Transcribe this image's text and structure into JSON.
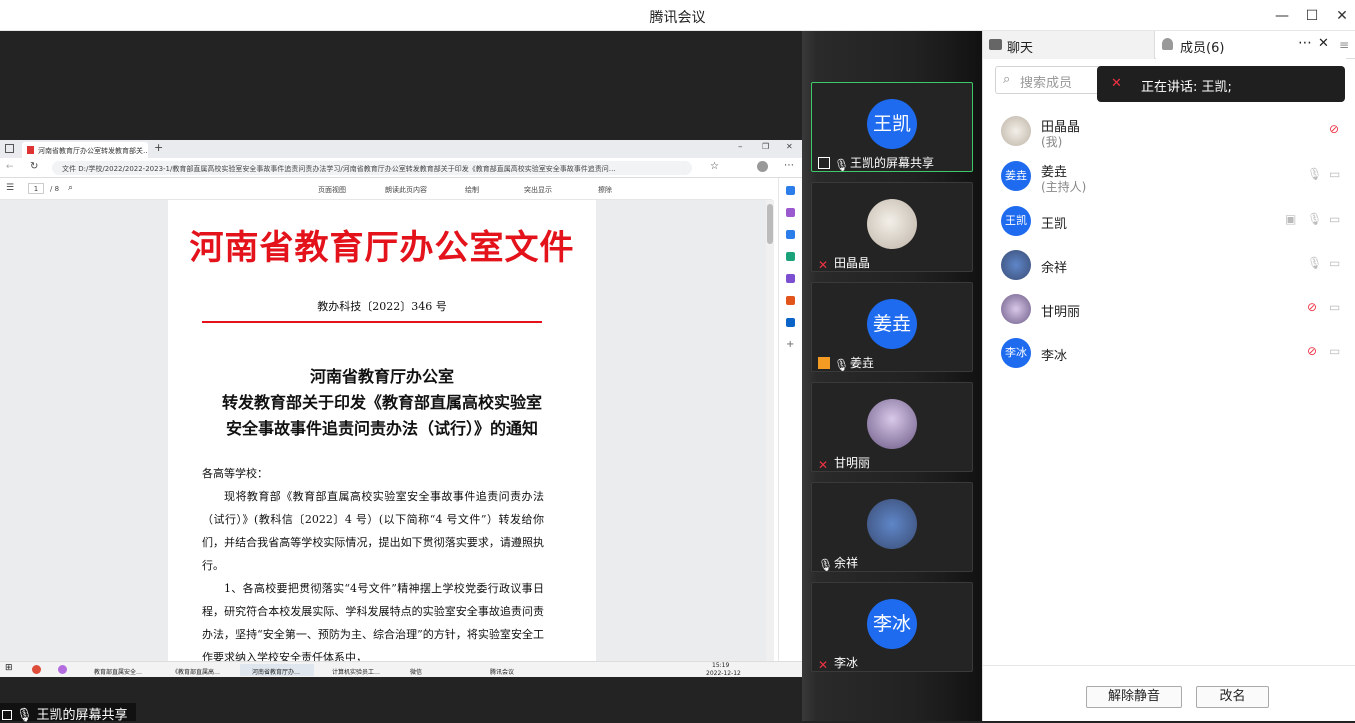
{
  "window": {
    "title": "腾讯会议"
  },
  "browser": {
    "tab_title": "河南省教育厅办公室转发教育部关…",
    "url": "文件  D:/学校/2022/2022-2023-1/教育部直属高校实验室安全事故事件追责问责办法学习/河南省教育厅办公室转发教育部关于印发《教育部直属高校实验室安全事故事件追责问…",
    "page_current": "1",
    "page_total": "/ 8",
    "tools": [
      "页面视图",
      "朗读此页内容",
      "绘制",
      "突出显示",
      "擦除"
    ]
  },
  "document": {
    "red_title": "河南省教育厅办公室文件",
    "doc_number": "教办科技〔2022〕346 号",
    "heading_line1": "河南省教育厅办公室",
    "heading_line2": "转发教育部关于印发《教育部直属高校实验室",
    "heading_line3": "安全事故事件追责问责办法（试行）》的通知",
    "salutation": "各高等学校：",
    "para1": "现将教育部《教育部直属高校实验室安全事故事件追责问责办法（试行）》(教科信〔2022〕4 号）(以下简称“4 号文件”）转发给你们，并结合我省高等学校实际情况，提出如下贯彻落实要求，请遵照执行。",
    "para2": "1、各高校要把贯彻落实“4号文件”精神摆上学校党委行政议事日程，研究符合本校发展实际、学科发展特点的实验室安全事故追责问责办法，坚持“安全第一、预防为主、综合治理”的方针，将实验室安全工作要求纳入学校安全责任体系中，"
  },
  "taskbar": {
    "apps": [
      "教育部直属安全…",
      "《教育部直属高…",
      "河南省教育厅办…",
      "计算机实验员工…",
      "微信",
      "腾讯会议"
    ],
    "time": "15:19",
    "date": "2022-12-12"
  },
  "share_label": "王凯的屏幕共享",
  "tiles": [
    {
      "avatar": "王凯",
      "label": "王凯的屏幕共享"
    },
    {
      "avatar": "",
      "label": "田晶晶"
    },
    {
      "avatar": "姜垚",
      "label": "姜垚"
    },
    {
      "avatar": "",
      "label": "甘明丽"
    },
    {
      "avatar": "",
      "label": "余祥"
    },
    {
      "avatar": "李冰",
      "label": "李冰"
    }
  ],
  "panel": {
    "chat_tab": "聊天",
    "members_tab": "成员(6)",
    "search_placeholder": "搜索成员",
    "speaking": "正在讲话: 王凯;",
    "members": [
      {
        "name": "田晶晶",
        "role": "(我)",
        "avatar": ""
      },
      {
        "name": "姜垚",
        "role": "(主持人)",
        "avatar": "姜垚"
      },
      {
        "name": "王凯",
        "role": "",
        "avatar": "王凯"
      },
      {
        "name": "余祥",
        "role": "",
        "avatar": ""
      },
      {
        "name": "甘明丽",
        "role": "",
        "avatar": ""
      },
      {
        "name": "李冰",
        "role": "",
        "avatar": "李冰"
      }
    ],
    "unmute_all": "解除静音",
    "rename": "改名"
  },
  "colors": {
    "accent": "#1e6bf0",
    "doc_red": "#e3121b",
    "active_border": "#3fc86a"
  }
}
